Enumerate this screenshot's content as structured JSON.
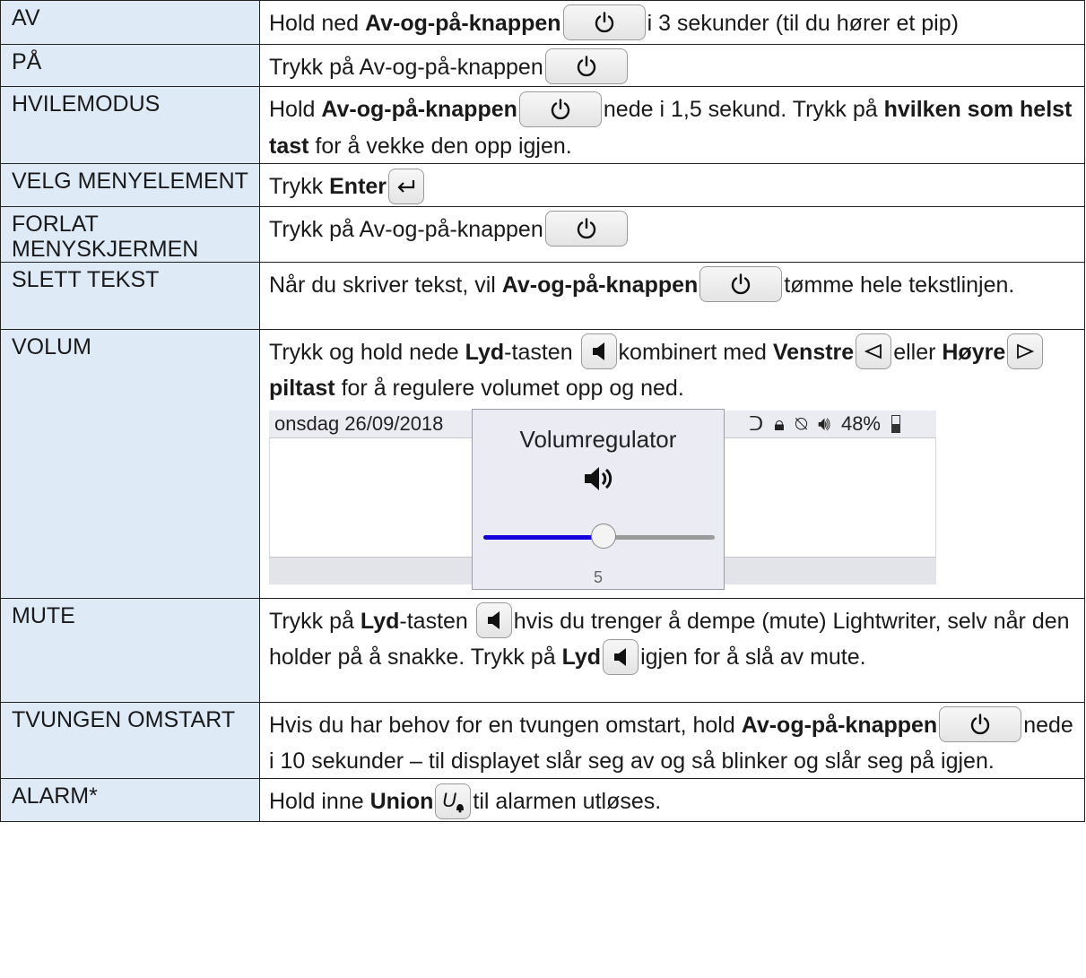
{
  "rows": [
    {
      "label": "AV",
      "parts": [
        [
          "t",
          "Hold ned "
        ],
        [
          "b",
          "Av-og-på-knappen"
        ],
        [
          "k",
          "power"
        ],
        [
          "t",
          "i 3 sekunder (til du hører et pip)"
        ]
      ]
    },
    {
      "label": "PÅ",
      "parts": [
        [
          "t",
          "Trykk på Av-og-på-knappen"
        ],
        [
          "k",
          "power"
        ]
      ]
    },
    {
      "label": "HVILEMODUS",
      "parts": [
        [
          "t",
          "Hold "
        ],
        [
          "b",
          "Av-og-på-knappen"
        ],
        [
          "k",
          "power"
        ],
        [
          "t",
          "nede i 1,5 sekund. Trykk på "
        ],
        [
          "b",
          "hvilken som helst tast"
        ],
        [
          "t",
          " for å vekke den opp igjen."
        ]
      ]
    },
    {
      "label": "VELG MENYELEMENT",
      "parts": [
        [
          "t",
          "Trykk "
        ],
        [
          "b",
          "Enter"
        ],
        [
          "k",
          "enter"
        ]
      ]
    },
    {
      "label": "FORLAT MENYSKJERMEN",
      "parts": [
        [
          "t",
          "Trykk på Av-og-på-knappen"
        ],
        [
          "k",
          "power"
        ]
      ]
    },
    {
      "label": "SLETT TEKST",
      "parts": [
        [
          "t",
          "Når du skriver tekst, vil "
        ],
        [
          "b",
          "Av-og-på-knappen"
        ],
        [
          "k",
          "power"
        ],
        [
          "t",
          "tømme hele tekstlinjen."
        ]
      ]
    },
    {
      "label": "VOLUM",
      "parts": [
        [
          "t",
          "Trykk og hold nede "
        ],
        [
          "b",
          "Lyd"
        ],
        [
          "t",
          "-tasten "
        ],
        [
          "k",
          "speaker"
        ],
        [
          "t",
          "kombinert med "
        ],
        [
          "b",
          "Venstre"
        ],
        [
          "k",
          "left"
        ],
        [
          "t",
          "eller "
        ],
        [
          "b",
          "Høyre"
        ],
        [
          "k",
          "right"
        ],
        [
          "b",
          "piltast"
        ],
        [
          "t",
          " for å regulere volumet opp og ned."
        ]
      ],
      "screenshot": true
    },
    {
      "label": "MUTE",
      "parts": [
        [
          "t",
          "Trykk på "
        ],
        [
          "b",
          "Lyd"
        ],
        [
          "t",
          "-tasten "
        ],
        [
          "k",
          "speaker"
        ],
        [
          "t",
          "hvis du trenger å dempe (mute) Lightwriter, selv når den holder på å snakke. Trykk på "
        ],
        [
          "b",
          "Lyd"
        ],
        [
          "k",
          "speaker"
        ],
        [
          "t",
          "igjen for å slå av mute."
        ]
      ]
    },
    {
      "label": "TVUNGEN OMSTART",
      "parts": [
        [
          "t",
          "Hvis du har behov for en tvungen omstart, hold "
        ],
        [
          "b",
          "Av-og-på-knappen"
        ],
        [
          "k",
          "power"
        ],
        [
          "t",
          "nede i 10 sekunder – til displayet slår seg av og så blinker og slår seg på igjen."
        ]
      ]
    },
    {
      "label": "ALARM*",
      "parts": [
        [
          "t",
          "Hold inne "
        ],
        [
          "b",
          "Union"
        ],
        [
          "k",
          "union"
        ],
        [
          "t",
          "til alarmen utløses."
        ]
      ]
    }
  ],
  "volume_screen": {
    "date": "onsdag 26/09/2018",
    "status_right": "48%",
    "popup_title": "Volumregulator",
    "level": 5,
    "level_fraction": 0.52,
    "accent": "#1500e0"
  }
}
